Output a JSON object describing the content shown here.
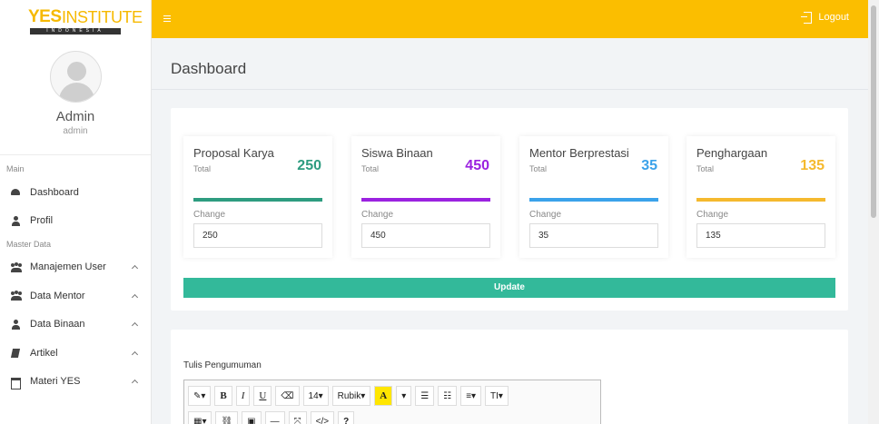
{
  "brand": {
    "name_bold": "YES",
    "name_light": "INSTITUTE",
    "tagline": "INDONESIA",
    "color": "#f6b900"
  },
  "profile": {
    "name": "Admin",
    "role": "admin"
  },
  "sidebar": {
    "sections": [
      {
        "title": "Main",
        "items": [
          {
            "label": "Dashboard",
            "icon": "dashboard-icon"
          },
          {
            "label": "Profil",
            "icon": "user-icon"
          }
        ]
      },
      {
        "title": "Master Data",
        "items": [
          {
            "label": "Manajemen User",
            "icon": "users-icon"
          },
          {
            "label": "Data Mentor",
            "icon": "users-icon"
          },
          {
            "label": "Data Binaan",
            "icon": "user-icon"
          },
          {
            "label": "Artikel",
            "icon": "book-icon"
          },
          {
            "label": "Materi YES",
            "icon": "calendar-icon"
          }
        ]
      }
    ]
  },
  "topbar": {
    "logout_label": "Logout",
    "color": "#fbbe00"
  },
  "page": {
    "title": "Dashboard"
  },
  "stats": [
    {
      "title": "Proposal Karya",
      "sub": "Total",
      "value": "250",
      "change_label": "Change",
      "change_value": "250",
      "color": "#2e9c80"
    },
    {
      "title": "Siswa Binaan",
      "sub": "Total",
      "value": "450",
      "change_label": "Change",
      "change_value": "450",
      "color": "#9b22e0"
    },
    {
      "title": "Mentor Berprestasi",
      "sub": "Total",
      "value": "35",
      "change_label": "Change",
      "change_value": "35",
      "color": "#3ba2ea"
    },
    {
      "title": "Penghargaan",
      "sub": "Total",
      "value": "135",
      "change_label": "Change",
      "change_value": "135",
      "color": "#f5b92e"
    }
  ],
  "update_label": "Update",
  "announcement": {
    "label": "Tulis Pengumuman",
    "toolbar_row1": [
      "✎▾",
      "B",
      "I",
      "U",
      "⌫",
      "14▾",
      "Rubik▾",
      "A",
      "▾",
      "☰",
      "☷",
      "≡▾",
      "TI▾"
    ],
    "toolbar_row2": [
      "▦▾",
      "⛓",
      "▣",
      "—",
      "⤧",
      "</>",
      "?"
    ]
  }
}
